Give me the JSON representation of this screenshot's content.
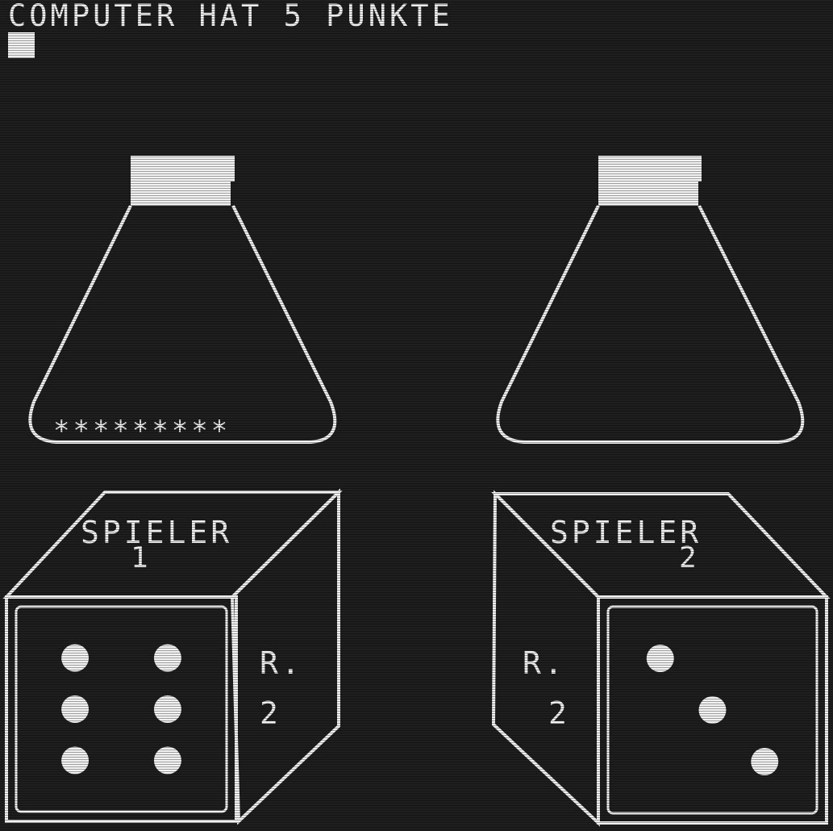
{
  "status_line": "COMPUTER HAT  5 PUNKTE",
  "colors": {
    "background": "#1f1f1f",
    "foreground": "#f2f2f2"
  },
  "cursor": {
    "icon": "block-cursor-icon"
  },
  "beakers": [
    {
      "owner": "spieler-1",
      "stars": "*********",
      "icon": "flask-icon"
    },
    {
      "owner": "spieler-2",
      "stars": "",
      "icon": "flask-icon"
    }
  ],
  "dice": [
    {
      "label": "SPIELER",
      "number": "1",
      "side_label": "R.",
      "side_value": "2",
      "face_value": 6,
      "icon": "die-icon"
    },
    {
      "label": "SPIELER",
      "number": "2",
      "side_label": "R.",
      "side_value": "2",
      "face_value": 3,
      "icon": "die-icon"
    }
  ]
}
